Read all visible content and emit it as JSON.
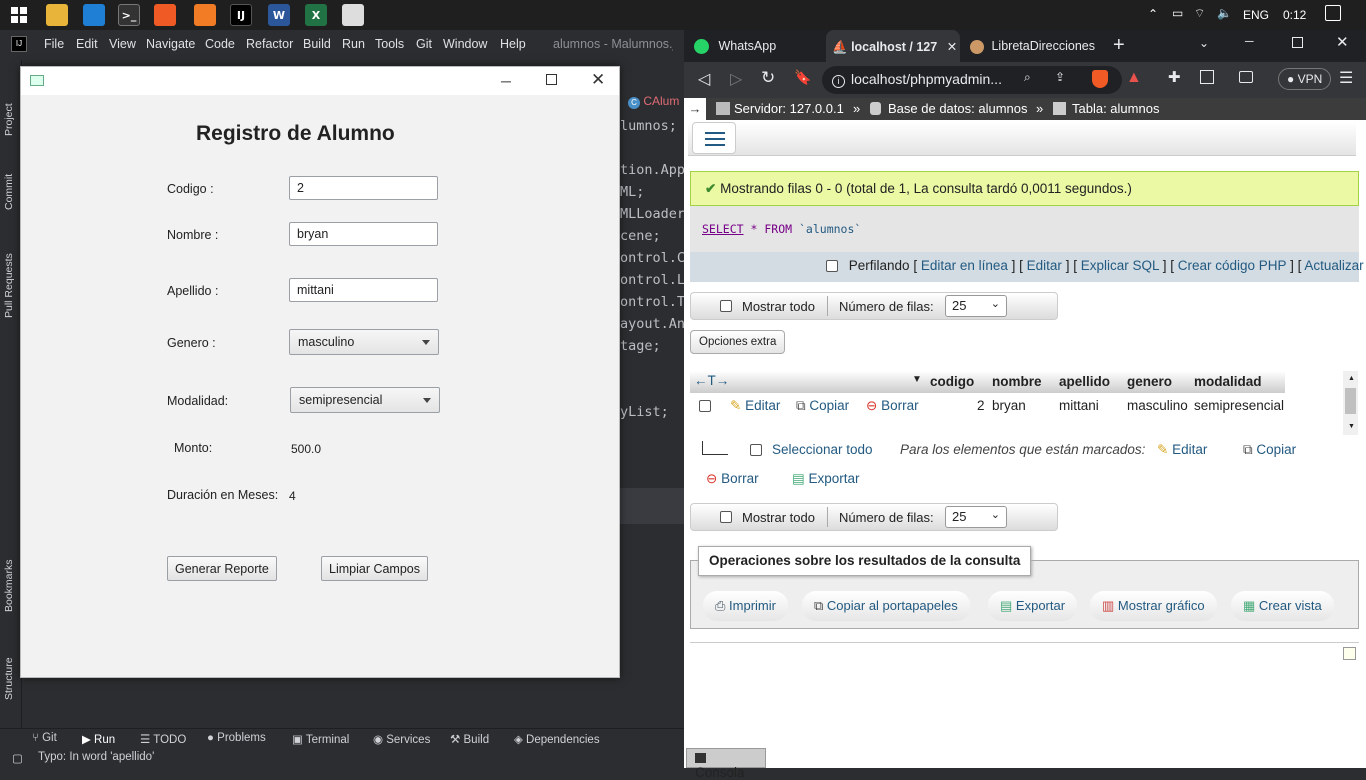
{
  "taskbar": {
    "lang": "ENG",
    "time": "0:12"
  },
  "ide": {
    "menu": [
      "File",
      "Edit",
      "View",
      "Navigate",
      "Code",
      "Refactor",
      "Build",
      "Run",
      "Tools",
      "Git",
      "Window",
      "Help"
    ],
    "title": "alumnos - Malumnos.java",
    "editor_tab": "CAlum",
    "code_lines": [
      "lumnos;",
      "",
      "tion.App",
      "ML;",
      "MLLoader",
      "cene;",
      "ontrol.C",
      "ontrol.La",
      "ontrol.Te",
      "ayout.An",
      "tage;",
      "",
      "",
      "yList;"
    ],
    "side_top": [
      "Project",
      "Commit",
      "Pull Requests"
    ],
    "side_bottom": [
      "Bookmarks",
      "Structure"
    ],
    "bottom_tabs": [
      "Git",
      "Run",
      "TODO",
      "Problems",
      "Terminal",
      "Services",
      "Build",
      "Dependencies"
    ],
    "status": "Typo: In word 'apellido'"
  },
  "form": {
    "heading": "Registro de Alumno",
    "codigo_label": "Codigo :",
    "codigo_value": "2",
    "nombre_label": "Nombre :",
    "nombre_value": "bryan",
    "apellido_label": "Apellido :",
    "apellido_value": "mittani",
    "genero_label": "Genero :",
    "genero_value": "masculino",
    "modalidad_label": "Modalidad:",
    "modalidad_value": "semipresencial",
    "monto_label": "Monto:",
    "monto_value": "500.0",
    "duracion_label": "Duración en Meses:",
    "duracion_value": "4",
    "btn_reporte": "Generar Reporte",
    "btn_limpiar": "Limpiar Campos"
  },
  "browser": {
    "tabs": [
      "WhatsApp",
      "localhost / 127",
      "LibretaDirecciones"
    ],
    "url": "localhost/phpmyadmin...",
    "vpn": "VPN",
    "breadcrumb": {
      "server": "Servidor: 127.0.0.1",
      "db": "Base de datos: alumnos",
      "table": "Tabla: alumnos"
    },
    "success": "Mostrando filas 0 - 0 (total de 1, La consulta tardó 0,0011 segundos.)",
    "sql": {
      "select": "SELECT",
      "star": "*",
      "from": "FROM",
      "table": "`alumnos`"
    },
    "profiling": "Perfilando",
    "links": [
      "Editar en línea",
      "Editar",
      "Explicar SQL",
      "Crear código PHP",
      "Actualizar"
    ],
    "show_all": "Mostrar todo",
    "rows_label": "Número de filas:",
    "rows_value": "25",
    "extra_options": "Opciones extra",
    "columns": [
      "codigo",
      "nombre",
      "apellido",
      "genero",
      "modalidad"
    ],
    "row": {
      "edit": "Editar",
      "copy": "Copiar",
      "delete": "Borrar",
      "codigo": "2",
      "nombre": "bryan",
      "apellido": "mittani",
      "genero": "masculino",
      "modalidad": "semipresencial"
    },
    "select_all": "Seleccionar todo",
    "marked": "Para los elementos que están marcados:",
    "bulk": {
      "edit": "Editar",
      "copy": "Copiar",
      "delete": "Borrar",
      "export": "Exportar"
    },
    "ops_title": "Operaciones sobre los resultados de la consulta",
    "ops": [
      "Imprimir",
      "Copiar al portapapeles",
      "Exportar",
      "Mostrar gráfico",
      "Crear vista"
    ],
    "console": "Consola"
  }
}
